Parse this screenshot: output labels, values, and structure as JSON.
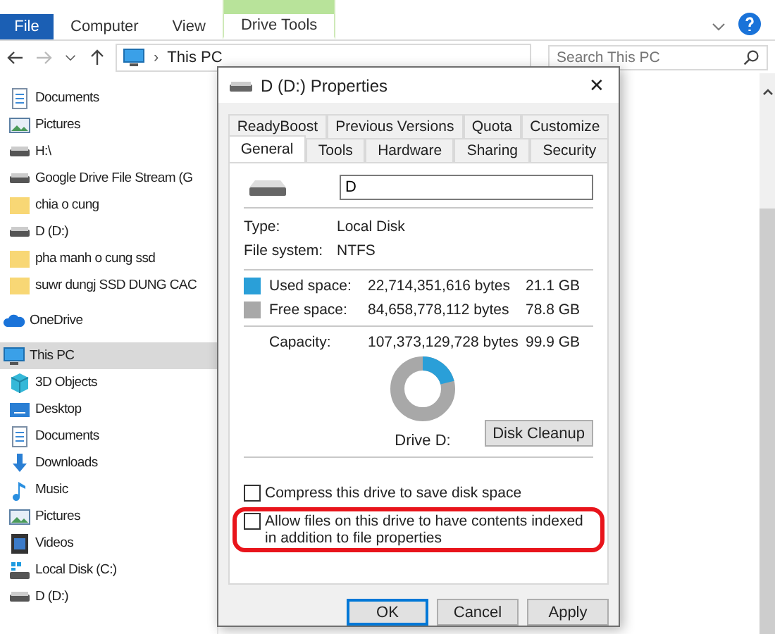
{
  "ribbon": {
    "tabs": [
      {
        "label": "File",
        "kind": "file",
        "selected": false
      },
      {
        "label": "Computer",
        "kind": "plain",
        "selected": false
      },
      {
        "label": "View",
        "kind": "plain",
        "selected": false
      },
      {
        "label": "Drive Tools",
        "kind": "contextual",
        "selected": true
      }
    ]
  },
  "address_bar": {
    "path": "This PC",
    "separator": "›"
  },
  "search": {
    "placeholder": "Search This PC"
  },
  "nav_pane": {
    "pinned": [
      {
        "label": "Documents",
        "kind": "documents",
        "selected": false
      },
      {
        "label": "Pictures",
        "kind": "pictures",
        "selected": false
      },
      {
        "label": "H:\\",
        "kind": "drive",
        "selected": false
      },
      {
        "label": "Google Drive File Stream (G",
        "kind": "drive",
        "selected": false
      },
      {
        "label": "chia o cung",
        "kind": "folder",
        "selected": false
      },
      {
        "label": "D (D:)",
        "kind": "drive",
        "selected": false
      },
      {
        "label": "pha manh o cung ssd",
        "kind": "folder",
        "selected": false
      },
      {
        "label": "suwr dungj SSD DUNG CAC",
        "kind": "folder",
        "selected": false
      }
    ],
    "items": [
      {
        "label": "OneDrive",
        "kind": "cloud",
        "selected": false
      },
      {
        "label": "This PC",
        "kind": "pc",
        "selected": true,
        "children": [
          {
            "label": "3D Objects",
            "kind": "objects",
            "selected": false
          },
          {
            "label": "Desktop",
            "kind": "desktop",
            "selected": false
          },
          {
            "label": "Documents",
            "kind": "documents",
            "selected": false
          },
          {
            "label": "Downloads",
            "kind": "downloads",
            "selected": false
          },
          {
            "label": "Music",
            "kind": "music",
            "selected": false
          },
          {
            "label": "Pictures",
            "kind": "pictures",
            "selected": false
          },
          {
            "label": "Videos",
            "kind": "videos",
            "selected": false
          },
          {
            "label": "Local Disk (C:)",
            "kind": "system-drive",
            "selected": false
          },
          {
            "label": "D (D:)",
            "kind": "drive",
            "selected": false
          }
        ]
      }
    ]
  },
  "dialog": {
    "title": "D (D:) Properties",
    "close": "✕",
    "tab_rows": [
      [
        {
          "label": "ReadyBoost",
          "selected": false
        },
        {
          "label": "Previous Versions",
          "selected": false
        },
        {
          "label": "Quota",
          "selected": false
        },
        {
          "label": "Customize",
          "selected": false
        }
      ],
      [
        {
          "label": "General",
          "selected": true
        },
        {
          "label": "Tools",
          "selected": false
        },
        {
          "label": "Hardware",
          "selected": false
        },
        {
          "label": "Sharing",
          "selected": false
        },
        {
          "label": "Security",
          "selected": false
        }
      ]
    ],
    "name_value": "D",
    "info": [
      {
        "label": "Type:",
        "value": "Local Disk"
      },
      {
        "label": "File system:",
        "value": "NTFS"
      }
    ],
    "space": [
      {
        "label": "Used space:",
        "bytes": "22,714,351,616 bytes",
        "size": "21.1 GB",
        "color": "#2a9fd8"
      },
      {
        "label": "Free space:",
        "bytes": "84,658,778,112 bytes",
        "size": "78.8 GB",
        "color": "#a8a8a8"
      }
    ],
    "capacity": {
      "label": "Capacity:",
      "bytes": "107,373,129,728 bytes",
      "size": "99.9 GB",
      "level": 0.21,
      "drive_label": "Drive D:"
    },
    "cleanup_button": "Disk Cleanup",
    "options": [
      {
        "label": "Compress this drive to save disk space",
        "checked": false,
        "highlighted": false
      },
      {
        "label": "Allow files on this drive to have contents indexed in addition to file properties",
        "checked": false,
        "highlighted": true
      }
    ],
    "buttons": [
      {
        "label": "OK",
        "default": true
      },
      {
        "label": "Cancel",
        "default": false
      },
      {
        "label": "Apply",
        "default": false
      }
    ]
  }
}
